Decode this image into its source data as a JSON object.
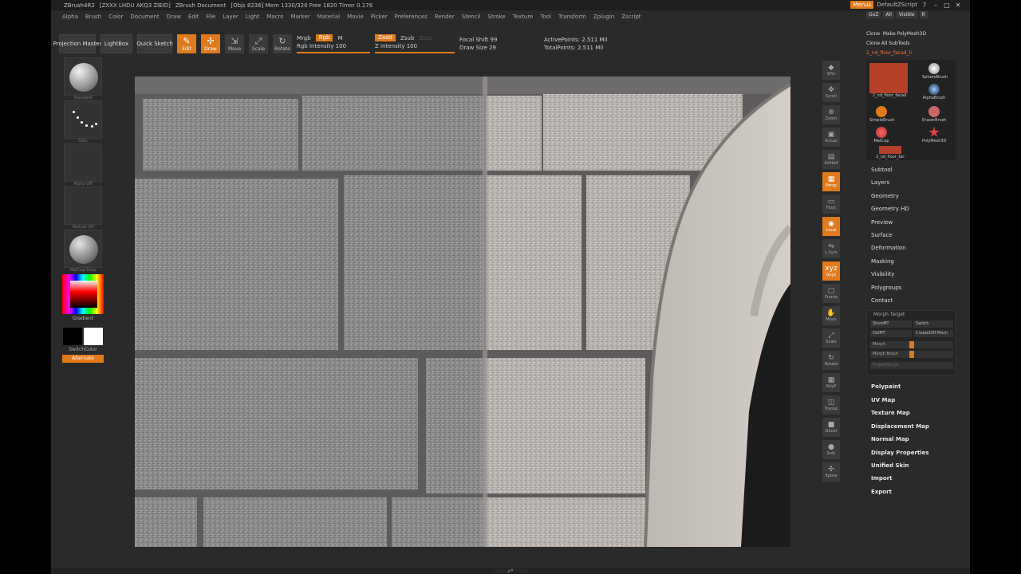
{
  "titlebar": {
    "app": "ZBrush4R2",
    "build": "[ZXXX LHDU AKQ3 ZIEID]",
    "document": "ZBrush Document",
    "stats": "[Objs 8236] Mem 1330/320 Free 1820 Timer 0.176",
    "menus_btn": "Menus",
    "script_label": "DefaultZScript"
  },
  "menubar": [
    "Alpha",
    "Brush",
    "Color",
    "Document",
    "Draw",
    "Edit",
    "File",
    "Layer",
    "Light",
    "Macro",
    "Marker",
    "Material",
    "Movie",
    "Picker",
    "Preferences",
    "Render",
    "Stencil",
    "Stroke",
    "Texture",
    "Tool",
    "Transform",
    "Zplugin",
    "Zscript"
  ],
  "shelf": {
    "projection_master": "Projection Master",
    "lightbox": "LightBox",
    "quick_sketch": "Quick Sketch",
    "tools": [
      {
        "label": "Edit",
        "active": true
      },
      {
        "label": "Draw",
        "active": true
      },
      {
        "label": "Move",
        "active": false
      },
      {
        "label": "Scale",
        "active": false
      },
      {
        "label": "Rotate",
        "active": false
      }
    ],
    "mrgb": "Mrgb",
    "rgb": "Rgb",
    "m": "M",
    "rgb_intensity": "Rgb Intensity 100",
    "zadd": "Zadd",
    "zsub": "Zsub",
    "zcut": "Zcut",
    "z_intensity": "Z Intensity 100",
    "focal_shift": "Focal Shift 99",
    "draw_size": "Draw Size 29",
    "active_points": "ActivePoints: 2.511 Mil",
    "total_points": "TotalPoints: 2.511 Mil",
    "rgb_intensity_value": 100,
    "z_intensity_value": 100
  },
  "lefttray": {
    "brush_label": "Standard",
    "stroke_label": "Dots",
    "alpha_label": "Alpha Off",
    "texture_label": "Texture Off",
    "material_label": "MatCap Gray",
    "gradient": "Gradient",
    "switch_color": "SwitchColor",
    "alternate": "Alternate"
  },
  "rightshelf": [
    {
      "label": "SPix",
      "glyph": "◆",
      "active": false
    },
    {
      "label": "Scroll",
      "glyph": "✥",
      "active": false
    },
    {
      "label": "Zoom",
      "glyph": "⊕",
      "active": false
    },
    {
      "label": "Actual",
      "glyph": "▣",
      "active": false
    },
    {
      "label": "AAHalf",
      "glyph": "▤",
      "active": false
    },
    {
      "label": "Persp",
      "glyph": "▦",
      "active": true
    },
    {
      "label": "Floor",
      "glyph": "▭",
      "active": false
    },
    {
      "label": "Local",
      "glyph": "◉",
      "active": true
    },
    {
      "label": "L.Sym",
      "glyph": "⇋",
      "active": false
    },
    {
      "label": "Gxyz",
      "glyph": "xyz",
      "active": true
    },
    {
      "label": "Frame",
      "glyph": "▢",
      "active": false
    },
    {
      "label": "Move",
      "glyph": "✋",
      "active": false
    },
    {
      "label": "Scale",
      "glyph": "⤢",
      "active": false
    },
    {
      "label": "Rotate",
      "glyph": "↻",
      "active": false
    },
    {
      "label": "PolyF",
      "glyph": "▦",
      "active": false
    },
    {
      "label": "Transp",
      "glyph": "◫",
      "active": false
    },
    {
      "label": "Ghost",
      "glyph": "■",
      "active": false
    },
    {
      "label": "Solo",
      "glyph": "●",
      "active": false
    },
    {
      "label": "Xpose",
      "glyph": "✣",
      "active": false
    }
  ],
  "toolpalette": {
    "top_buttons": [
      "GoZ",
      "All",
      "Visible",
      "R"
    ],
    "clone": "Clone",
    "make_polymesh": "Make PolyMesh3D",
    "clone_all_subtools": "Clone All SubTools",
    "current_tool": "2_nd_floor_facad_li",
    "tool_items": [
      "2_nd_floor_facad",
      "SphereBrush",
      "AlphaBrush",
      "SimpleBrush",
      "EraserBrush",
      "MatCap",
      "PolyMesh3D",
      "2_nd_floor_fac"
    ],
    "sections": [
      "Subtool",
      "Layers",
      "Geometry",
      "Geometry HD",
      "Preview",
      "Surface",
      "Deformation",
      "Masking",
      "Visibility",
      "Polygroups",
      "Contact"
    ],
    "morph_target": {
      "title": "Morph Target",
      "storemt": "StoreMT",
      "switch": "Switch",
      "delmt": "DelMT",
      "create_diff_mesh": "CreateDiff Mesh",
      "morph": "Morph",
      "morph_value": 0.5,
      "morph_brush": "Morph Brush",
      "morph_brush_value": 0.5,
      "progressive": "ProjectMorph"
    },
    "bottom_sections": [
      "Polypaint",
      "UV Map",
      "Texture Map",
      "Displacement Map",
      "Normal Map",
      "Display Properties",
      "Unified Skin",
      "Import",
      "Export"
    ]
  },
  "bottombar": "::::::::: ▲▼ :::::::::",
  "colors": {
    "accent": "#e07a1c",
    "ui_bg": "#2a2a2a",
    "title_bg": "#1f1f1f",
    "stone": "#8a8788",
    "arch": "#c9c4bd"
  }
}
